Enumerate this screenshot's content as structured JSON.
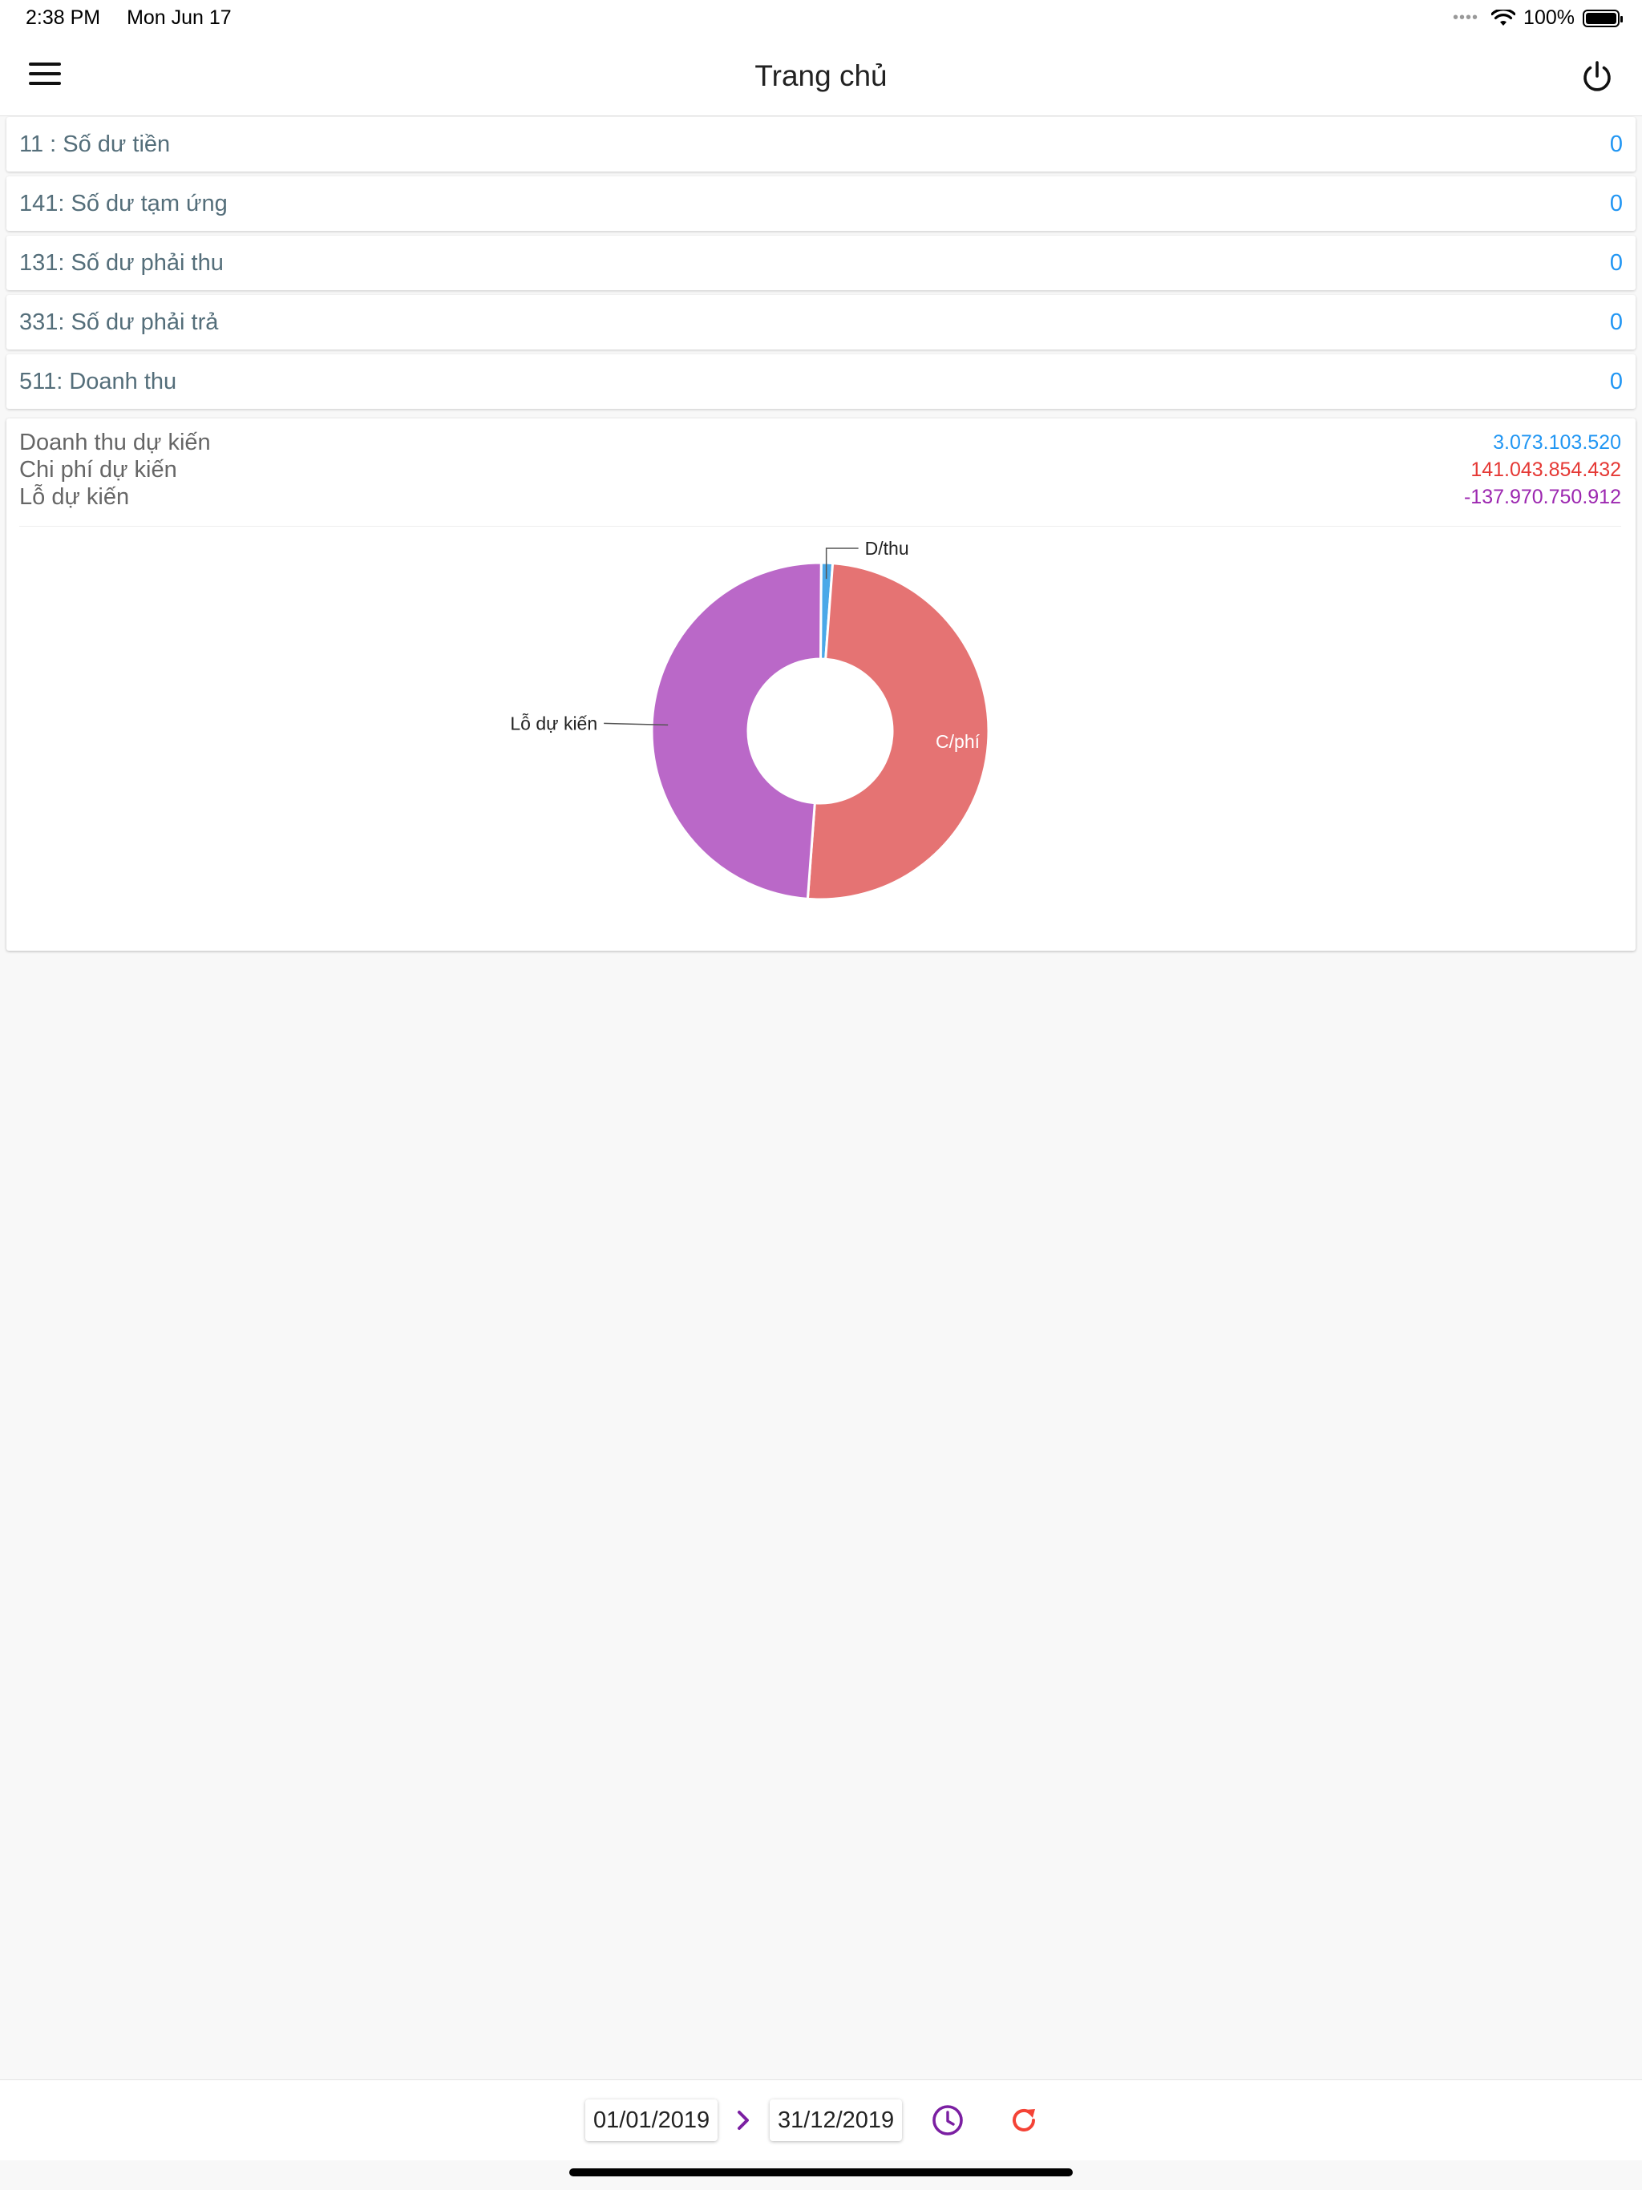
{
  "status_bar": {
    "time": "2:38 PM",
    "date": "Mon Jun 17",
    "battery": "100%"
  },
  "header": {
    "title": "Trang chủ",
    "menu_icon": "menu-icon",
    "power_icon": "power-icon"
  },
  "accounts": [
    {
      "label": "11 : Số dư tiền",
      "value": "0"
    },
    {
      "label": "141: Số dư tạm ứng",
      "value": "0"
    },
    {
      "label": "131: Số dư phải thu",
      "value": "0"
    },
    {
      "label": "331: Số dư phải trả",
      "value": "0"
    },
    {
      "label": "511: Doanh thu",
      "value": "0"
    }
  ],
  "summary": {
    "revenue": {
      "label": "Doanh thu dự kiến",
      "value": "3.073.103.520",
      "color": "#2196f3"
    },
    "cost": {
      "label": "Chi phí dự kiến",
      "value": "141.043.854.432",
      "color": "#e53935"
    },
    "loss": {
      "label": "Lỗ dự kiến",
      "value": "-137.970.750.912",
      "color": "#9c27b0"
    }
  },
  "chart_data": {
    "type": "pie",
    "donut": true,
    "categories": [
      "D/thu",
      "C/phí",
      "Lỗ dự kiến"
    ],
    "values": [
      3073103520,
      141043854432,
      137970750912
    ],
    "colors": [
      "#4aa8e8",
      "#e57373",
      "#ba68c8"
    ],
    "labels": [
      "D/thu",
      "C/phí",
      "Lỗ dự kiến"
    ]
  },
  "bottom_bar": {
    "date_from": "01/01/2019",
    "date_to": "31/12/2019",
    "arrow_icon": "chevron-right-icon",
    "clock_icon": "clock-icon",
    "refresh_icon": "refresh-icon",
    "arrow_color": "#7b1fa2",
    "clock_color": "#7b1fa2",
    "refresh_color": "#f44336"
  }
}
